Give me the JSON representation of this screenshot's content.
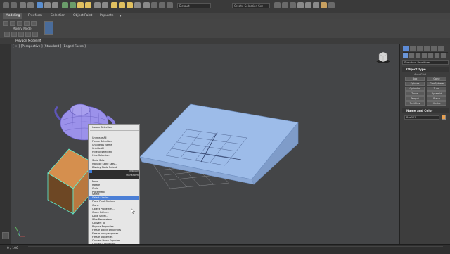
{
  "toolbar": {
    "workspace_combo": "Default",
    "selection_set_combo": "Create Selection Set"
  },
  "ribbon": {
    "tabs": [
      "Modeling",
      "Freeform",
      "Selection",
      "Object Paint",
      "Populate"
    ],
    "active_tab": "Modeling",
    "modify_mode_label": "Modify Mode",
    "polygon_modeling_label": "Polygon Modeling"
  },
  "viewport": {
    "label": "[ + ] [Perspective ] [Standard ] [Edged Faces ]"
  },
  "command_panel": {
    "category": "Standard Primitives",
    "object_type_header": "Object Type",
    "autogrid_label": "AutoGrid",
    "primitives": [
      "Box",
      "Cone",
      "Sphere",
      "GeoSphere",
      "Cylinder",
      "Tube",
      "Torus",
      "Pyramid",
      "Teapot",
      "Plane",
      "TextPlus",
      "Hedra"
    ],
    "name_color_header": "Name and Color",
    "name_value": "Box001",
    "color_swatch": "#e8a050"
  },
  "quad_menu": {
    "items_top": [
      "Isolate Selection",
      "Unfreeze All",
      "Freeze Selection",
      "Unhide by Name",
      "Unhide All",
      "Hide Unselected",
      "Hide Selection",
      "State Sets",
      "Manage State Sets...",
      "Display Mode Fallout"
    ],
    "section_labels": [
      "display",
      "transform"
    ],
    "items_bottom": [
      "Move",
      "Rotate",
      "Scale",
      "Placement",
      "Select",
      "Select Similar",
      "Place Pivot Surface",
      "Clone",
      "Object Properties...",
      "Curve Editor...",
      "Dope Sheet...",
      "Wire Parameters...",
      "Convert To:",
      "Physics Properties...",
      "Freeze object properties",
      "Freeze proxy exporter",
      "Freeze properties",
      "Convert Proxy Exporter",
      "Convert Convert to:",
      "Follow properties",
      "Follow Edit"
    ],
    "highlighted": "Select Similar"
  },
  "status_bar": {
    "frame_counter": "0 / 100"
  },
  "colors": {
    "viewport_bg": "#444547",
    "ramp": "#94b6e6",
    "box": "#d58f4e",
    "teapot": "#9a90e8",
    "highlight": "#4b7fd6"
  }
}
